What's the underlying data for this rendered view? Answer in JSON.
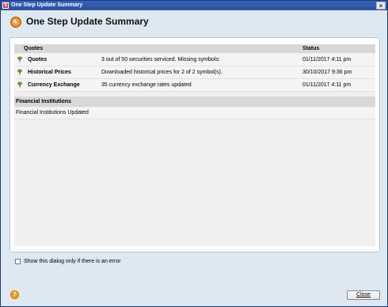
{
  "window": {
    "title": "One Step Update Summary",
    "close_glyph": "×"
  },
  "header": {
    "title": "One Step Update Summary"
  },
  "table": {
    "columns": [
      "Quotes",
      "Status"
    ],
    "rows": [
      {
        "name": "Quotes",
        "description": "3 out of 50 securities serviced. Missing symbols:",
        "status": "01/11/2017  4:11 pm"
      },
      {
        "name": "Historical Prices",
        "description": "Downloaded historical prices for 2 of 2 symbol(s).",
        "status": "30/10/2017  9:36 pm"
      },
      {
        "name": "Currency Exchange",
        "description": "35 currency exchange rates updated",
        "status": "01/11/2017  4:11 pm"
      }
    ]
  },
  "financial": {
    "heading": "Financial Institutions",
    "message": "Financial Institutions Updated"
  },
  "footer": {
    "checkbox_label": "Show this dialog only if there is an error",
    "checkbox_checked": false,
    "close_label": "Close",
    "help_glyph": "?"
  }
}
